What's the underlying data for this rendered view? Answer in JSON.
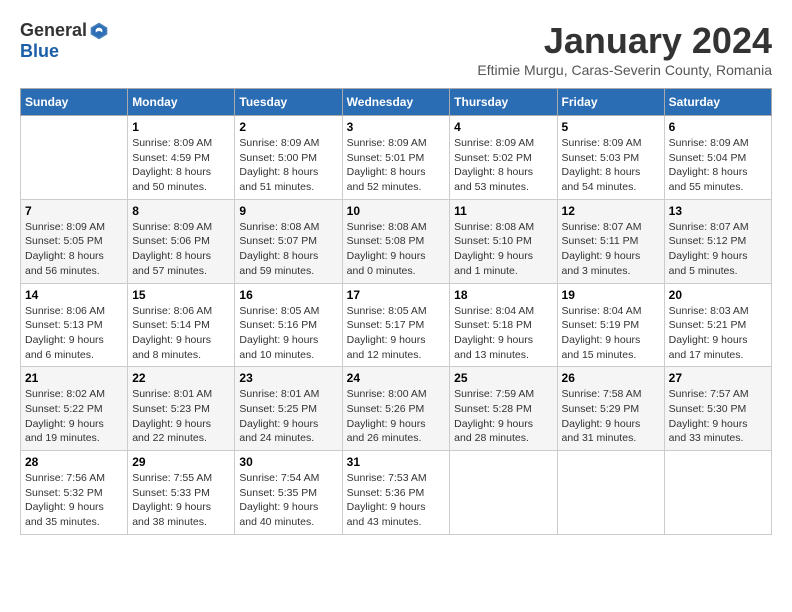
{
  "logo": {
    "general": "General",
    "blue": "Blue"
  },
  "title": "January 2024",
  "subtitle": "Eftimie Murgu, Caras-Severin County, Romania",
  "headers": [
    "Sunday",
    "Monday",
    "Tuesday",
    "Wednesday",
    "Thursday",
    "Friday",
    "Saturday"
  ],
  "weeks": [
    [
      {
        "day": "",
        "sunrise": "",
        "sunset": "",
        "daylight": ""
      },
      {
        "day": "1",
        "sunrise": "Sunrise: 8:09 AM",
        "sunset": "Sunset: 4:59 PM",
        "daylight": "Daylight: 8 hours and 50 minutes."
      },
      {
        "day": "2",
        "sunrise": "Sunrise: 8:09 AM",
        "sunset": "Sunset: 5:00 PM",
        "daylight": "Daylight: 8 hours and 51 minutes."
      },
      {
        "day": "3",
        "sunrise": "Sunrise: 8:09 AM",
        "sunset": "Sunset: 5:01 PM",
        "daylight": "Daylight: 8 hours and 52 minutes."
      },
      {
        "day": "4",
        "sunrise": "Sunrise: 8:09 AM",
        "sunset": "Sunset: 5:02 PM",
        "daylight": "Daylight: 8 hours and 53 minutes."
      },
      {
        "day": "5",
        "sunrise": "Sunrise: 8:09 AM",
        "sunset": "Sunset: 5:03 PM",
        "daylight": "Daylight: 8 hours and 54 minutes."
      },
      {
        "day": "6",
        "sunrise": "Sunrise: 8:09 AM",
        "sunset": "Sunset: 5:04 PM",
        "daylight": "Daylight: 8 hours and 55 minutes."
      }
    ],
    [
      {
        "day": "7",
        "sunrise": "Sunrise: 8:09 AM",
        "sunset": "Sunset: 5:05 PM",
        "daylight": "Daylight: 8 hours and 56 minutes."
      },
      {
        "day": "8",
        "sunrise": "Sunrise: 8:09 AM",
        "sunset": "Sunset: 5:06 PM",
        "daylight": "Daylight: 8 hours and 57 minutes."
      },
      {
        "day": "9",
        "sunrise": "Sunrise: 8:08 AM",
        "sunset": "Sunset: 5:07 PM",
        "daylight": "Daylight: 8 hours and 59 minutes."
      },
      {
        "day": "10",
        "sunrise": "Sunrise: 8:08 AM",
        "sunset": "Sunset: 5:08 PM",
        "daylight": "Daylight: 9 hours and 0 minutes."
      },
      {
        "day": "11",
        "sunrise": "Sunrise: 8:08 AM",
        "sunset": "Sunset: 5:10 PM",
        "daylight": "Daylight: 9 hours and 1 minute."
      },
      {
        "day": "12",
        "sunrise": "Sunrise: 8:07 AM",
        "sunset": "Sunset: 5:11 PM",
        "daylight": "Daylight: 9 hours and 3 minutes."
      },
      {
        "day": "13",
        "sunrise": "Sunrise: 8:07 AM",
        "sunset": "Sunset: 5:12 PM",
        "daylight": "Daylight: 9 hours and 5 minutes."
      }
    ],
    [
      {
        "day": "14",
        "sunrise": "Sunrise: 8:06 AM",
        "sunset": "Sunset: 5:13 PM",
        "daylight": "Daylight: 9 hours and 6 minutes."
      },
      {
        "day": "15",
        "sunrise": "Sunrise: 8:06 AM",
        "sunset": "Sunset: 5:14 PM",
        "daylight": "Daylight: 9 hours and 8 minutes."
      },
      {
        "day": "16",
        "sunrise": "Sunrise: 8:05 AM",
        "sunset": "Sunset: 5:16 PM",
        "daylight": "Daylight: 9 hours and 10 minutes."
      },
      {
        "day": "17",
        "sunrise": "Sunrise: 8:05 AM",
        "sunset": "Sunset: 5:17 PM",
        "daylight": "Daylight: 9 hours and 12 minutes."
      },
      {
        "day": "18",
        "sunrise": "Sunrise: 8:04 AM",
        "sunset": "Sunset: 5:18 PM",
        "daylight": "Daylight: 9 hours and 13 minutes."
      },
      {
        "day": "19",
        "sunrise": "Sunrise: 8:04 AM",
        "sunset": "Sunset: 5:19 PM",
        "daylight": "Daylight: 9 hours and 15 minutes."
      },
      {
        "day": "20",
        "sunrise": "Sunrise: 8:03 AM",
        "sunset": "Sunset: 5:21 PM",
        "daylight": "Daylight: 9 hours and 17 minutes."
      }
    ],
    [
      {
        "day": "21",
        "sunrise": "Sunrise: 8:02 AM",
        "sunset": "Sunset: 5:22 PM",
        "daylight": "Daylight: 9 hours and 19 minutes."
      },
      {
        "day": "22",
        "sunrise": "Sunrise: 8:01 AM",
        "sunset": "Sunset: 5:23 PM",
        "daylight": "Daylight: 9 hours and 22 minutes."
      },
      {
        "day": "23",
        "sunrise": "Sunrise: 8:01 AM",
        "sunset": "Sunset: 5:25 PM",
        "daylight": "Daylight: 9 hours and 24 minutes."
      },
      {
        "day": "24",
        "sunrise": "Sunrise: 8:00 AM",
        "sunset": "Sunset: 5:26 PM",
        "daylight": "Daylight: 9 hours and 26 minutes."
      },
      {
        "day": "25",
        "sunrise": "Sunrise: 7:59 AM",
        "sunset": "Sunset: 5:28 PM",
        "daylight": "Daylight: 9 hours and 28 minutes."
      },
      {
        "day": "26",
        "sunrise": "Sunrise: 7:58 AM",
        "sunset": "Sunset: 5:29 PM",
        "daylight": "Daylight: 9 hours and 31 minutes."
      },
      {
        "day": "27",
        "sunrise": "Sunrise: 7:57 AM",
        "sunset": "Sunset: 5:30 PM",
        "daylight": "Daylight: 9 hours and 33 minutes."
      }
    ],
    [
      {
        "day": "28",
        "sunrise": "Sunrise: 7:56 AM",
        "sunset": "Sunset: 5:32 PM",
        "daylight": "Daylight: 9 hours and 35 minutes."
      },
      {
        "day": "29",
        "sunrise": "Sunrise: 7:55 AM",
        "sunset": "Sunset: 5:33 PM",
        "daylight": "Daylight: 9 hours and 38 minutes."
      },
      {
        "day": "30",
        "sunrise": "Sunrise: 7:54 AM",
        "sunset": "Sunset: 5:35 PM",
        "daylight": "Daylight: 9 hours and 40 minutes."
      },
      {
        "day": "31",
        "sunrise": "Sunrise: 7:53 AM",
        "sunset": "Sunset: 5:36 PM",
        "daylight": "Daylight: 9 hours and 43 minutes."
      },
      {
        "day": "",
        "sunrise": "",
        "sunset": "",
        "daylight": ""
      },
      {
        "day": "",
        "sunrise": "",
        "sunset": "",
        "daylight": ""
      },
      {
        "day": "",
        "sunrise": "",
        "sunset": "",
        "daylight": ""
      }
    ]
  ]
}
